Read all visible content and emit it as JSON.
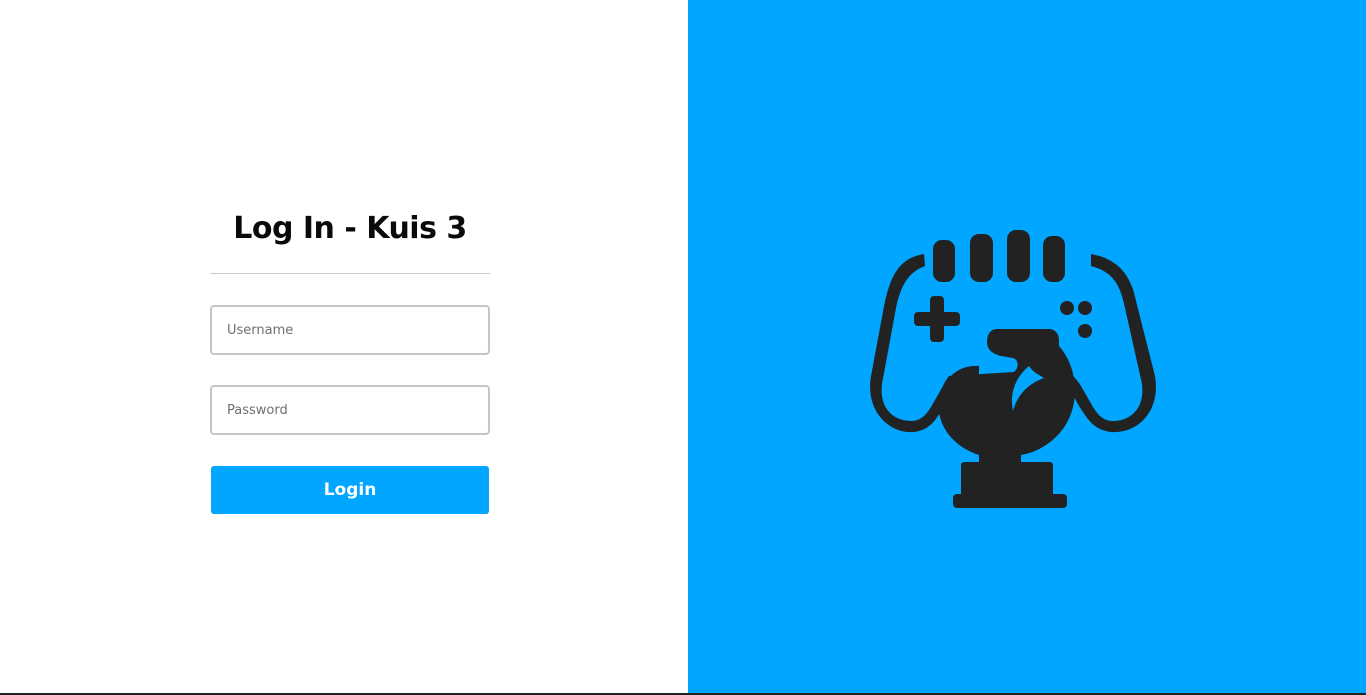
{
  "login_form": {
    "title": "Log In - Kuis 3",
    "username_placeholder": "Username",
    "password_placeholder": "Password",
    "login_label": "Login"
  },
  "colors": {
    "accent": "#00a6ff",
    "logo": "#222222",
    "background_left": "#ffffff"
  },
  "brand": {
    "logo_icon": "gamepad-trophy-icon"
  }
}
